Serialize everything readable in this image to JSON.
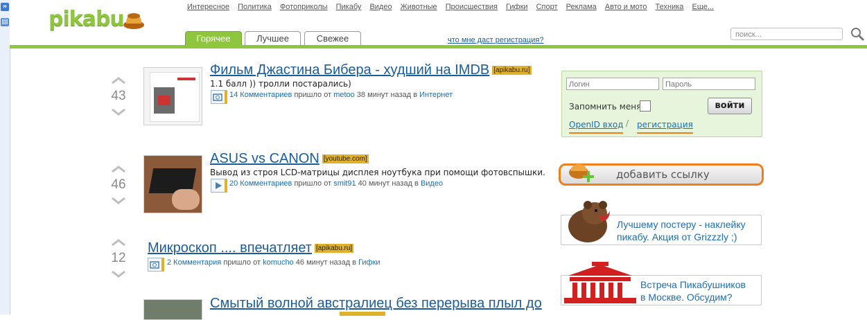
{
  "header": {
    "logo": "pikabu",
    "nav": [
      "Интересное",
      "Политика",
      "Фотоприколы",
      "Пикабу",
      "Видео",
      "Животные",
      "Происшествия",
      "Гифки",
      "Спорт",
      "Реклама",
      "Авто и мото",
      "Техника",
      "Еще..."
    ],
    "tabs": [
      {
        "label": "Горячее",
        "active": true
      },
      {
        "label": "Лучшее",
        "active": false
      },
      {
        "label": "Свежее",
        "active": false
      }
    ],
    "register_link": "что мне даст регистрация?",
    "search_placeholder": "поиск..."
  },
  "posts": [
    {
      "score": "43",
      "title": "Фильм Джастина Бибера - худший на IMDB",
      "source": "[apikabu.ru]",
      "description": "1.1 балл )) тролли постарались)",
      "type_icon": "photo-icon",
      "comments": "14 Комментариев",
      "came_from": "пришло от",
      "author": "metoo",
      "time": "38 минут назад в",
      "category": "Интернет"
    },
    {
      "score": "46",
      "title": "ASUS vs CANON",
      "source": "[youtube.com]",
      "description": "Вывод из строя LCD-матрицы дисплея ноутбука при помощи фотовспышки.",
      "type_icon": "video-icon",
      "comments": "20 Комментариев",
      "came_from": "пришло от",
      "author": "smit91",
      "time": "40 минут назад в",
      "category": "Видео"
    },
    {
      "score": "12",
      "title": "Микроскоп .... впечатляет",
      "source": "[apikabu.ru]",
      "description": "",
      "type_icon": "photo-icon",
      "comments": "2 Комментария",
      "came_from": "пришло от",
      "author": "komucho",
      "time": "46 минут назад в",
      "category": "Гифки"
    },
    {
      "score": "",
      "title": "Смытый волной австралиец без перерыва плыл до",
      "source": "",
      "description": "",
      "type_icon": "",
      "comments": "",
      "came_from": "",
      "author": "",
      "time": "",
      "category": ""
    }
  ],
  "login": {
    "login_placeholder": "Логин",
    "password_placeholder": "Пароль",
    "remember": "Запомнить меня",
    "button": "войти",
    "openid": "OpenID вход",
    "separator": "/",
    "register": "регистрация"
  },
  "add_link": "добавить ссылку",
  "promos": [
    {
      "text_line1": "Лучшему постеру - наклейку",
      "text_line2": "пикабу. Акция от Grizzzly ;)",
      "icon": "bear-icon"
    },
    {
      "text_line1": "Встреча Пикабушников",
      "text_line2": "в Москве. Обсудим?",
      "icon": "theatre-icon"
    }
  ],
  "colors": {
    "brand_green": "#8ec63f",
    "accent_orange": "#f07e1a",
    "source_badge": "#e0b12b",
    "link_blue": "#1a5d9c"
  }
}
